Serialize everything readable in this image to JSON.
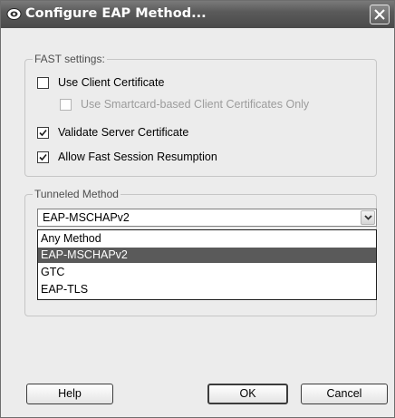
{
  "window": {
    "title": "Configure EAP Method...",
    "icons": {
      "app": "eap-app-icon",
      "close": "close-icon"
    }
  },
  "fast_settings": {
    "legend": "FAST settings:",
    "use_client_certificate": {
      "label": "Use Client Certificate",
      "checked": false
    },
    "smartcard_only": {
      "label": "Use Smartcard-based Client Certificates Only",
      "checked": false,
      "enabled": false
    },
    "validate_server_certificate": {
      "label": "Validate Server Certificate",
      "checked": true
    },
    "allow_fast_session_resumption": {
      "label": "Allow Fast Session Resumption",
      "checked": true
    }
  },
  "tunneled_method": {
    "legend": "Tunneled Method",
    "selected": "EAP-MSCHAPv2",
    "options": [
      "Any Method",
      "EAP-MSCHAPv2",
      "GTC",
      "EAP-TLS"
    ],
    "highlighted_index": 1
  },
  "buttons": {
    "help": "Help",
    "ok": "OK",
    "cancel": "Cancel"
  }
}
